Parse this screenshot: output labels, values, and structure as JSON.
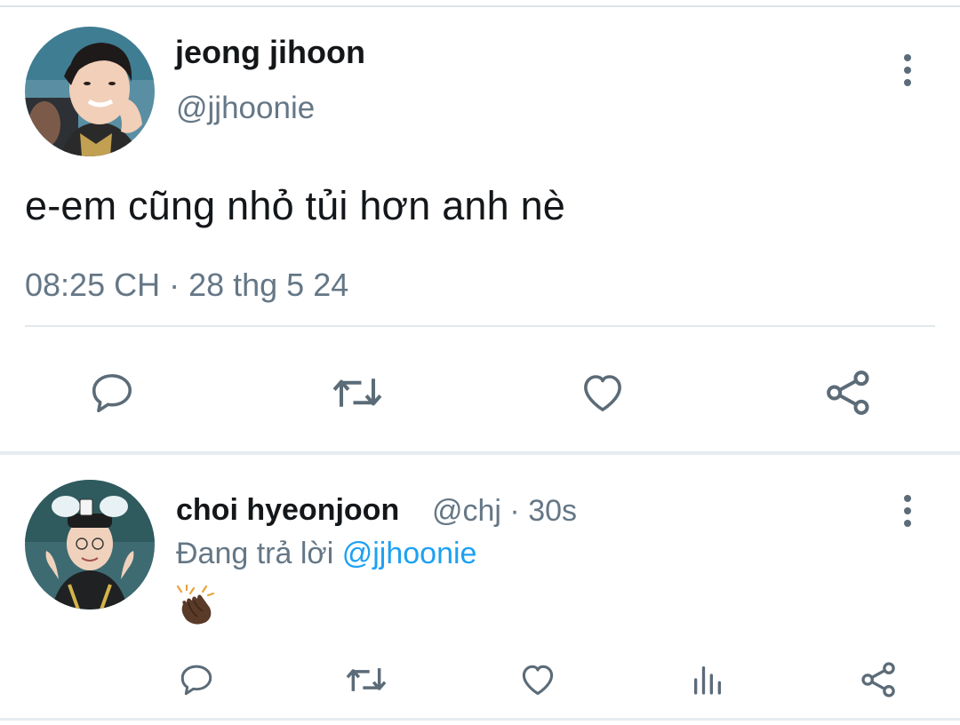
{
  "main_tweet": {
    "author_name": "jeong jihoon",
    "author_handle": "@jjhoonie",
    "text": "e-em cũng nhỏ tủi hơn anh nè",
    "meta": "08:25 CH · 28 thg 5 24",
    "actions": [
      "reply-icon",
      "retweet-icon",
      "like-icon",
      "share-icon"
    ]
  },
  "reply": {
    "author_name": "choi hyeonjoon",
    "author_handle_time": "@chj · 30s",
    "replying_prefix": "Đang trả lời",
    "replying_mention": "@jjhoonie",
    "content_emoji": "clapping-hands-emoji",
    "actions": [
      "reply-icon",
      "retweet-icon",
      "like-icon",
      "analytics-icon",
      "share-icon"
    ]
  },
  "colors": {
    "text": "#14171a",
    "muted": "#657786",
    "link": "#1da1f2",
    "icon": "#5b6b78",
    "divider": "#e6ecf0"
  }
}
